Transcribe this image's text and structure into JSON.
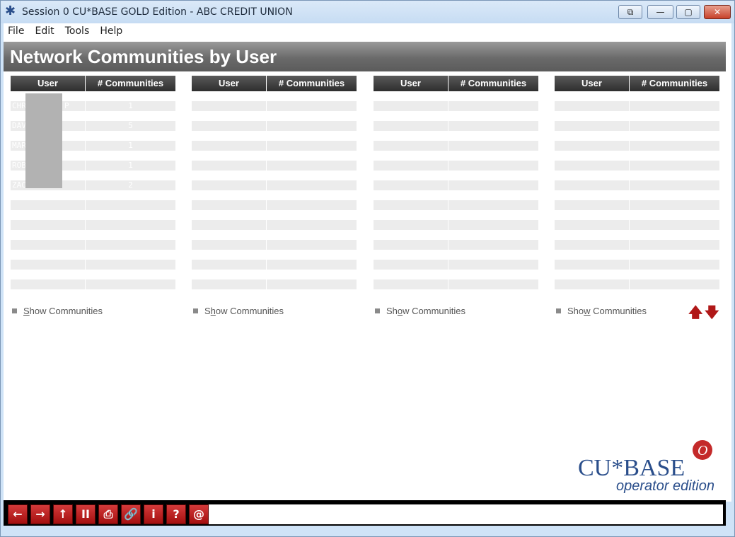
{
  "window": {
    "title": "Session 0 CU*BASE GOLD Edition - ABC CREDIT UNION",
    "controls": {
      "restore": "⧉",
      "minimize": "—",
      "maximize": "▢",
      "close": "✕"
    }
  },
  "menu": [
    "File",
    "Edit",
    "Tools",
    "Help"
  ],
  "page": {
    "title": "Network Communities by User"
  },
  "columns": {
    "user": "User",
    "communities": "# Communities"
  },
  "groups": [
    {
      "rows": [
        {
          "user": "CHR",
          "count": "1",
          "suffix": "P"
        },
        {
          "user": "DAV",
          "count": "5",
          "suffix": ""
        },
        {
          "user": "MAR",
          "count": "1",
          "suffix": ""
        },
        {
          "user": "ROB",
          "count": "1",
          "suffix": ""
        },
        {
          "user": "ZAC",
          "count": "2",
          "suffix": ""
        }
      ]
    },
    {
      "rows": []
    },
    {
      "rows": []
    },
    {
      "rows": []
    }
  ],
  "show_link": {
    "prefix": "S",
    "first": "how Communities",
    "alt_split": [
      "Sh",
      "o",
      "w Communities"
    ]
  },
  "show_links": [
    {
      "pre": "",
      "u": "S",
      "post": "how Communities"
    },
    {
      "pre": "S",
      "u": "h",
      "post": "ow Communities"
    },
    {
      "pre": "Sh",
      "u": "o",
      "post": "w Communities"
    },
    {
      "pre": "Sho",
      "u": "w",
      "post": " Communities"
    }
  ],
  "scroll": {
    "up": "🡅",
    "down": "🡇"
  },
  "logo": {
    "brand": "CU*BASE",
    "badge": "O",
    "sub": "operator edition"
  },
  "toolbar": [
    "←",
    "→",
    "↑",
    "II",
    "⎙",
    "🔗",
    "i",
    "?",
    "@"
  ],
  "colors": {
    "header_bg": "#6a6a6a",
    "col_header_bg": "#3a3a3a",
    "accent_red": "#b01818",
    "logo_blue": "#2a4e8b"
  }
}
